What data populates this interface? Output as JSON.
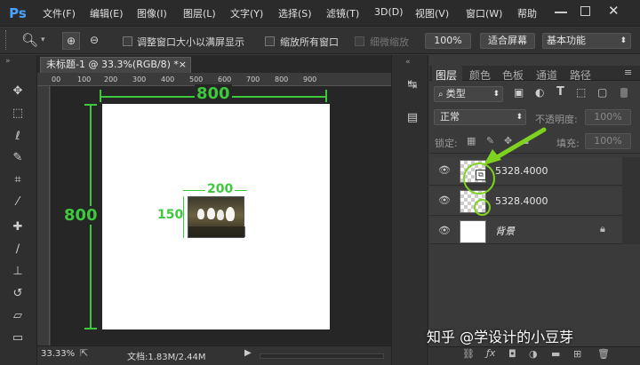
{
  "app": {
    "logo": "Ps"
  },
  "menu": [
    "文件(F)",
    "编辑(E)",
    "图像(I)",
    "图层(L)",
    "文字(Y)",
    "选择(S)",
    "滤镜(T)",
    "3D(D)",
    "视图(V)",
    "窗口(W)",
    "帮助"
  ],
  "options": {
    "fit_window_label": "调整窗口大小以满屏显示",
    "zoom_all_label": "缩放所有窗口",
    "scrubby_label": "细微缩放",
    "percent_btn": "100%",
    "fit_screen_btn": "适合屏幕",
    "workspace_select": "基本功能"
  },
  "document": {
    "tab_title": "未标题-1 @ 33.3%(RGB/8) *",
    "ruler_ticks": [
      "00",
      "100",
      "200",
      "300",
      "400",
      "500",
      "600",
      "700",
      "800",
      "900"
    ]
  },
  "annotations": {
    "canvas_width": "800",
    "canvas_height": "800",
    "image_width": "200",
    "image_height": "150"
  },
  "status": {
    "zoom": "33.33%",
    "doc_info": "文档:1.83M/2.44M"
  },
  "panel": {
    "tabs": [
      "图层",
      "颜色",
      "色板",
      "通道",
      "路径"
    ],
    "filter_label": "类型",
    "blend_mode": "正常",
    "opacity_label": "不透明度:",
    "opacity_value": "100%",
    "lock_label": "锁定:",
    "fill_label": "填充:",
    "fill_value": "100%",
    "layers": [
      {
        "name": "5328.4000"
      },
      {
        "name": "5328.4000"
      },
      {
        "name": "背景"
      }
    ]
  },
  "watermark": "知乎 @学设计的小豆芽",
  "colors": {
    "accent_green": "#3ec83e",
    "ps_blue": "#4aa3ff"
  }
}
